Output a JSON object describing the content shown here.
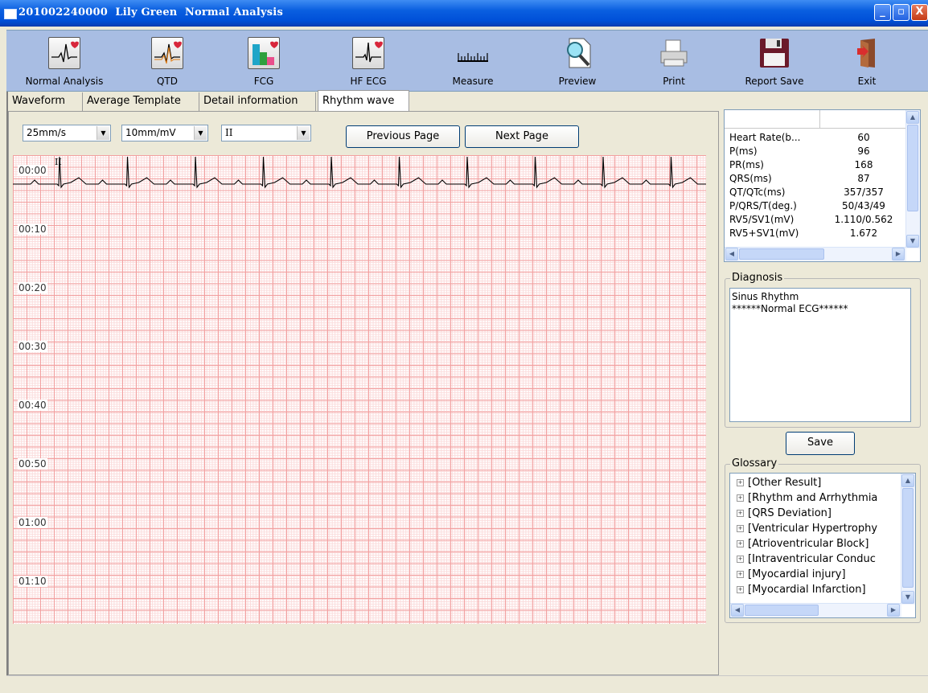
{
  "window": {
    "title": "201002240000  Lily Green  Normal Analysis",
    "min_glyph": "_",
    "max_glyph": "▫",
    "close_glyph": "X"
  },
  "toolbar": {
    "items": [
      {
        "label": "Normal Analysis",
        "icon": "ecg-heart-icon"
      },
      {
        "label": "QTD",
        "icon": "qtd-icon"
      },
      {
        "label": "FCG",
        "icon": "fcg-icon"
      },
      {
        "label": "HF ECG",
        "icon": "hf-ecg-icon"
      },
      {
        "label": "Measure",
        "icon": "ruler-icon"
      },
      {
        "label": "Preview",
        "icon": "magnifier-icon"
      },
      {
        "label": "Print",
        "icon": "printer-icon"
      },
      {
        "label": "Report Save",
        "icon": "floppy-disk-icon"
      },
      {
        "label": "Exit",
        "icon": "exit-door-icon"
      }
    ]
  },
  "tabs": [
    {
      "label": "Waveform",
      "active": false
    },
    {
      "label": "Average Template",
      "active": false
    },
    {
      "label": "Detail information",
      "active": false
    },
    {
      "label": "Rhythm wave",
      "active": true
    }
  ],
  "controls": {
    "speed": "25mm/s",
    "gain": "10mm/mV",
    "lead": "II",
    "prev_label": "Previous Page",
    "next_label": "Next Page"
  },
  "rhythm": {
    "lead_label": "II",
    "time_labels": [
      "00:00",
      "00:10",
      "00:20",
      "00:30",
      "00:40",
      "00:50",
      "01:00",
      "01:10"
    ],
    "beats": 10
  },
  "measurements": {
    "rows": [
      {
        "k": "Heart Rate(b...",
        "v": "60"
      },
      {
        "k": "P(ms)",
        "v": "96"
      },
      {
        "k": "PR(ms)",
        "v": "168"
      },
      {
        "k": "QRS(ms)",
        "v": "87"
      },
      {
        "k": "QT/QTc(ms)",
        "v": "357/357"
      },
      {
        "k": "P/QRS/T(deg.)",
        "v": "50/43/49"
      },
      {
        "k": "RV5/SV1(mV)",
        "v": "1.110/0.562"
      },
      {
        "k": "RV5+SV1(mV)",
        "v": "1.672"
      }
    ]
  },
  "diagnosis": {
    "title": "Diagnosis",
    "text": "Sinus Rhythm\n******Normal ECG******",
    "save_label": "Save"
  },
  "glossary": {
    "title": "Glossary",
    "items": [
      "[Other Result]",
      "[Rhythm and Arrhythmia",
      "[QRS Deviation]",
      "[Ventricular Hypertrophy",
      "[Atrioventricular Block]",
      "[Intraventricular Conduc",
      "[Myocardial injury]",
      "[Myocardial Infarction]"
    ]
  }
}
